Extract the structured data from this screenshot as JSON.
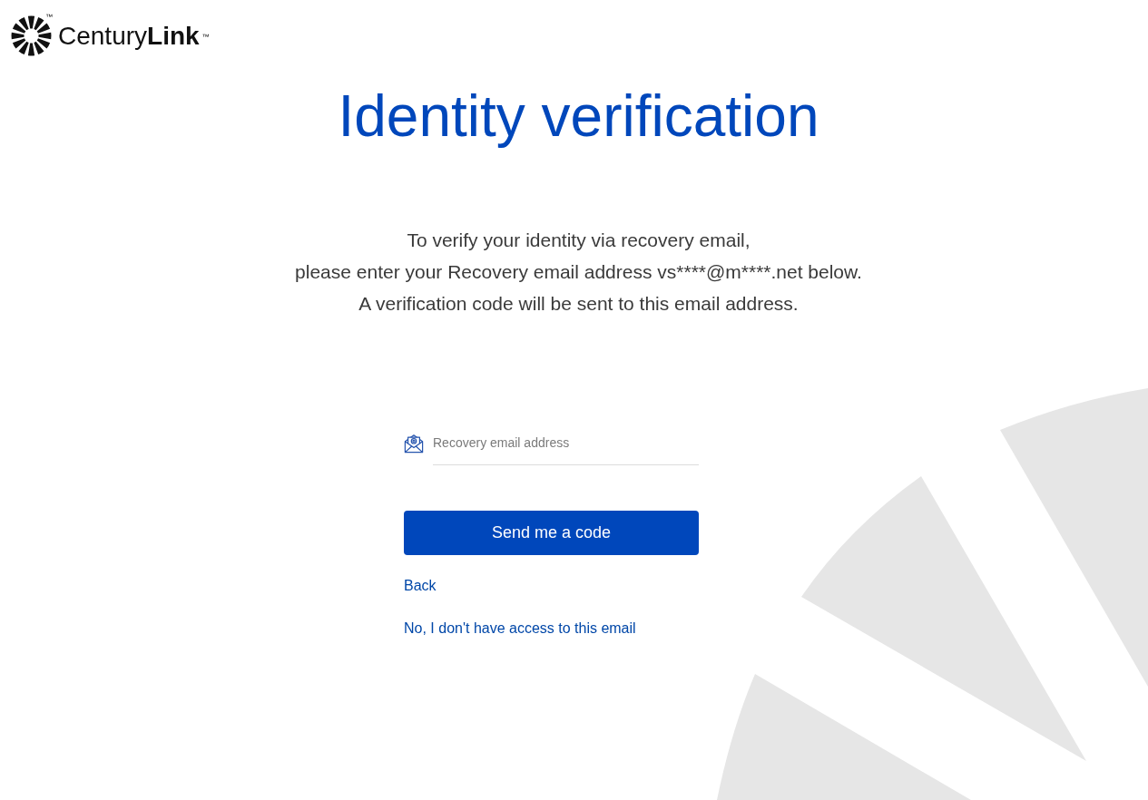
{
  "logo": {
    "icon_trademark": "™",
    "wordmark": "Century**Link**",
    "wordmark_trademark": "™"
  },
  "title": "Identity verification",
  "instructions": [
    "To verify your identity via recovery email,",
    "please enter your Recovery email address vs****@m****.net below.",
    "A verification code will be sent to this email address."
  ],
  "email_field": {
    "placeholder": "Recovery email address"
  },
  "submit_button": {
    "label": "Send me a code"
  },
  "links": [
    "Back",
    "No, I don't have access to this email"
  ]
}
